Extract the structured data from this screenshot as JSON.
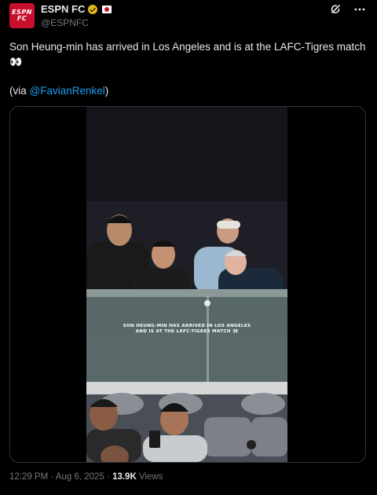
{
  "account": {
    "display_name": "ESPN FC",
    "handle": "@ESPNFC",
    "avatar_text_top": "ESPN",
    "avatar_text_bottom": "FC",
    "verified_color": "#e2b719"
  },
  "tweet": {
    "text": "Son Heung-min has arrived in Los Angeles and is at the LAFC-Tigres match",
    "emoji": "👀",
    "via_prefix": "(via ",
    "via_link": "@FavianRenkel",
    "via_suffix": ")"
  },
  "video": {
    "caption_line1": "SON HEUNG-MIN HAS ARRIVED IN LOS ANGELES",
    "caption_line2": "AND IS AT THE LAFC-TIGRES MATCH 👀"
  },
  "footer": {
    "time": "12:29 PM · Aug 6, 2025 · ",
    "views_count": "13.9K",
    "views_label": " Views"
  },
  "icons": {
    "grok": "grok-icon",
    "more": "more-icon"
  },
  "colors": {
    "link": "#1d9bf0",
    "muted": "#71767b",
    "avatar_bg": "#c8102e"
  }
}
